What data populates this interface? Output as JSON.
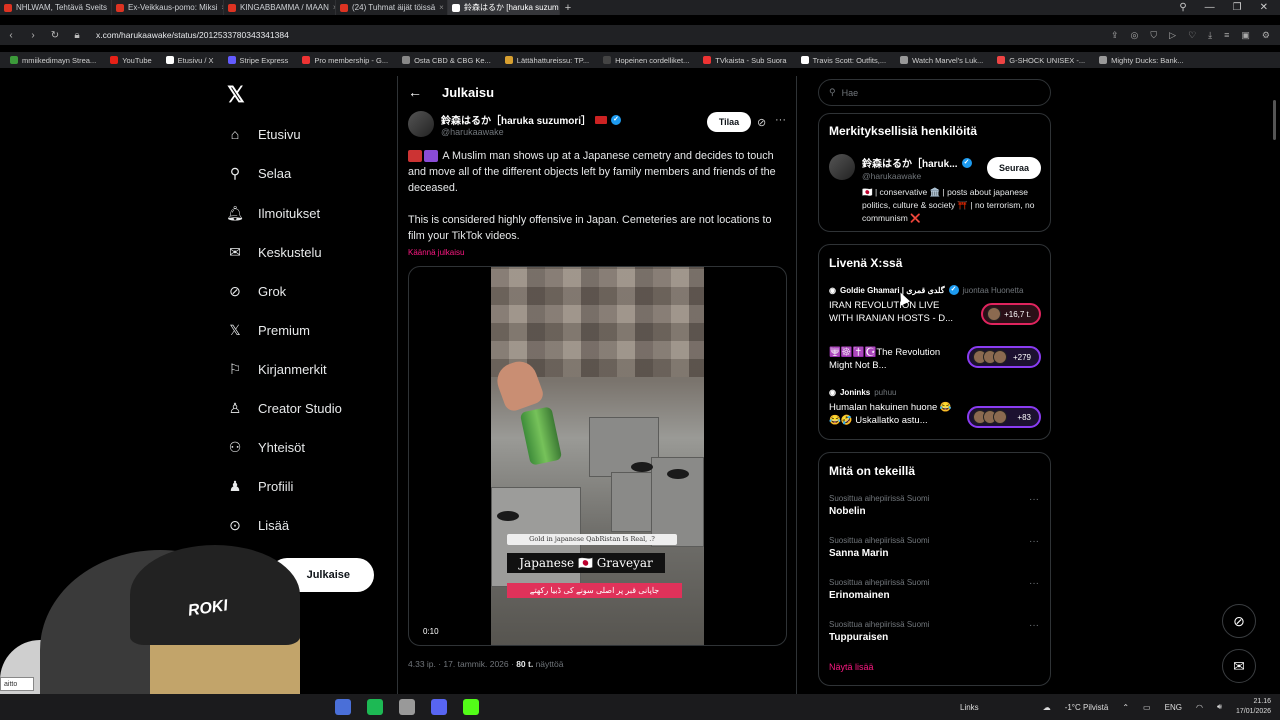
{
  "browser": {
    "tabs": [
      {
        "label": "NHLWAM, Tehtävä Sveits"
      },
      {
        "label": "Ex-Veikkaus-pomo: Miksi"
      },
      {
        "label": "KINGABBAMMA / MAAN"
      },
      {
        "label": "(24) Tuhmat äijät töissä"
      },
      {
        "label": "鈴森はるか [haruka suzum",
        "active": true
      }
    ],
    "url": "x.com/harukaawake/status/2012533780343341384",
    "bookmarks": [
      {
        "label": "mmiikedimayn Strea...",
        "color": "#3c9a3a"
      },
      {
        "label": "YouTube",
        "color": "#e62117"
      },
      {
        "label": "Etusivu / X",
        "color": "#ffffff"
      },
      {
        "label": "Stripe Express",
        "color": "#635bff"
      },
      {
        "label": "Pro membership - G...",
        "color": "#e33"
      },
      {
        "label": "Osta CBD & CBG Ke...",
        "color": "#888"
      },
      {
        "label": "Lättähattureissu: TP...",
        "color": "#d8a030"
      },
      {
        "label": "Hopeinen cordelliket...",
        "color": "#444"
      },
      {
        "label": "TVkaista - Sub Suora",
        "color": "#e33"
      },
      {
        "label": "Travis Scott: Outfits,...",
        "color": "#fff"
      },
      {
        "label": "Watch Marvel's Luk...",
        "color": "#999"
      },
      {
        "label": "G-SHOCK UNISEX -...",
        "color": "#e44"
      },
      {
        "label": "Mighty Ducks: Bank...",
        "color": "#999"
      }
    ]
  },
  "nav": {
    "items": [
      {
        "label": "Etusivu",
        "icon": "home-icon",
        "glyph": "⌂"
      },
      {
        "label": "Selaa",
        "icon": "search-icon",
        "glyph": "⚲"
      },
      {
        "label": "Ilmoitukset",
        "icon": "bell-icon",
        "glyph": "🔔︎"
      },
      {
        "label": "Keskustelu",
        "icon": "mail-icon",
        "glyph": "✉"
      },
      {
        "label": "Grok",
        "icon": "grok-icon",
        "glyph": "⊘"
      },
      {
        "label": "Premium",
        "icon": "x-icon",
        "glyph": "𝕏"
      },
      {
        "label": "Kirjanmerkit",
        "icon": "bookmark-icon",
        "glyph": "⚐"
      },
      {
        "label": "Creator Studio",
        "icon": "creator-icon",
        "glyph": "♙"
      },
      {
        "label": "Yhteisöt",
        "icon": "communities-icon",
        "glyph": "⚇"
      },
      {
        "label": "Profiili",
        "icon": "profile-icon",
        "glyph": "♟"
      },
      {
        "label": "Lisää",
        "icon": "more-icon",
        "glyph": "⊙"
      }
    ],
    "post_label": "Julkaise"
  },
  "main": {
    "header_title": "Julkaisu",
    "author_name": "鈴森はるか［haruka suzumori］",
    "author_handle": "@harukaawake",
    "subscribe_label": "Tilaa",
    "paragraph1": "A Muslim man shows up at a Japanese cemetry and decides to touch and move all of the different objects left by family members and friends of the deceased.",
    "paragraph2": "This is considered highly offensive in Japan. Cemeteries are not locations to film your TikTok videos.",
    "translate_label": "Käännä julkaisu",
    "video": {
      "caption_small": "Gold in japanese QabRistan Is Real, .?",
      "caption_big": "Japanese 🇯🇵 Graveyar",
      "caption_urdu": "جاپانی قبر پر اصلی سونے کی ڈبیا رکھتے",
      "timecode": "0:10"
    },
    "meta_time": "4.33 ip. · 17. tammik. 2026 · ",
    "meta_views": "80 t.",
    "meta_views_suffix": " näyttöä"
  },
  "right": {
    "search_placeholder": "Hae",
    "relevant_title": "Merkityksellisiä henkilöitä",
    "relevant_person": {
      "name": "鈴森はるか［haruk...",
      "handle": "@harukaawake",
      "follow_label": "Seuraa",
      "bio": "🇯🇵 | conservative 🏛️ | posts about japanese politics, culture & society ⛩️ | no terrorism, no communism ❌"
    },
    "live_title": "Livenä X:ssä",
    "live": [
      {
        "host": "Goldie Ghamari | گلدی قمری",
        "role": "juontaa Huonetta",
        "title": "IRAN REVOLUTION LIVE WITH IRANIAN HOSTS - D...",
        "count": "+16,7 t."
      },
      {
        "host": "",
        "role": "",
        "title": "🕎☸️✝️☪️The Revolution Might Not B...",
        "count": "+279"
      },
      {
        "host": "Joninks",
        "role": "puhuu",
        "title": "Humalan hakuinen huone 😂😂🤣 Uskallatko astu...",
        "count": "+83"
      }
    ],
    "trends_title": "Mitä on tekeillä",
    "trends": [
      {
        "context": "Suosittua aihepiirissä Suomi",
        "name": "Nobelin"
      },
      {
        "context": "Suosittua aihepiirissä Suomi",
        "name": "Sanna Marin"
      },
      {
        "context": "Suosittua aihepiirissä Suomi",
        "name": "Erinomainen"
      },
      {
        "context": "Suosittua aihepiirissä Suomi",
        "name": "Tuppuraisen"
      }
    ],
    "show_more": "Näytä lisää"
  },
  "webcam": {
    "cap_logo": "ROKI"
  },
  "small_box": "aitto",
  "taskbar": {
    "links": "Links",
    "weather": "-1°C  Pilvistä",
    "lang": "ENG",
    "time": "21.16",
    "date": "17/01/2026"
  }
}
